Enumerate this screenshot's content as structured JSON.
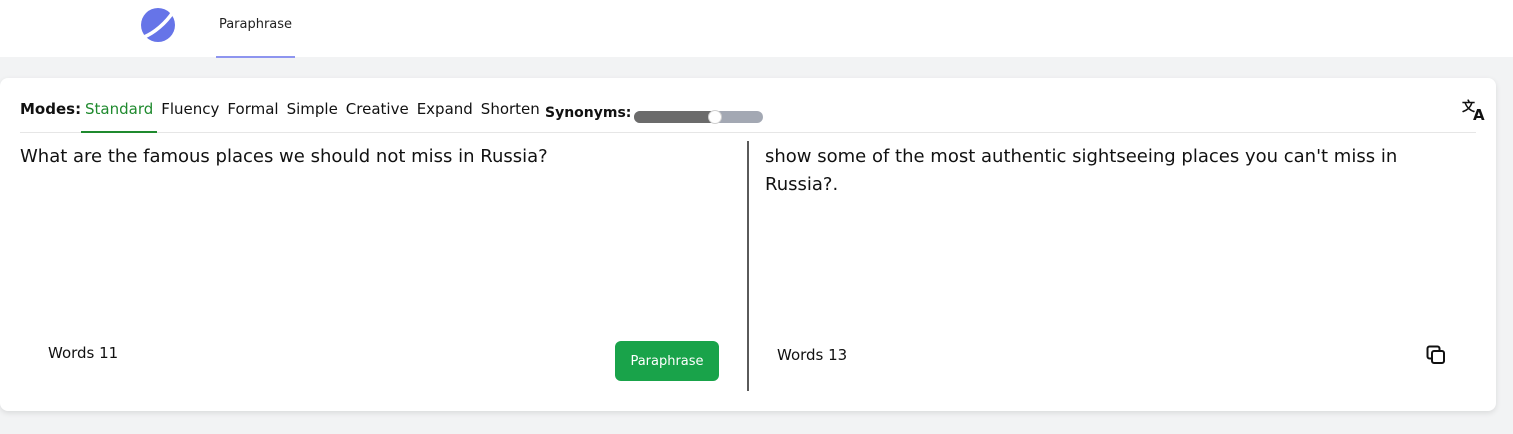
{
  "header": {
    "logo_icon": "planet-logo-icon",
    "tab_label": "Paraphrase",
    "tab_underline_color": "#8e95ef"
  },
  "toolbar": {
    "modes_label": "Modes:",
    "modes": [
      "Standard",
      "Fluency",
      "Formal",
      "Simple",
      "Creative",
      "Expand",
      "Shorten"
    ],
    "active_mode": "Standard",
    "active_color": "#1f8a2e",
    "synonyms_label": "Synonyms:",
    "synonyms_level": 0.6,
    "translate_icon": "translate-icon"
  },
  "input": {
    "text": "What are the famous places we should not miss in Russia?",
    "word_count_label": "Words 11",
    "button_label": "Paraphrase",
    "button_color": "#19a34a"
  },
  "output": {
    "text": "show some of the most authentic sightseeing places you can't miss in Russia?.",
    "word_count_label": "Words 13",
    "copy_icon": "copy-icon"
  }
}
